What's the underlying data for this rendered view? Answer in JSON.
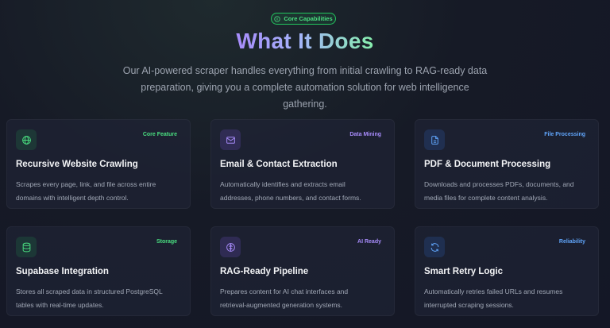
{
  "header": {
    "badge_label": "Core Capabilities",
    "title": "What It Does",
    "subtitle_line1": "Our AI-powered scraper handles everything from initial crawling to RAG-ready data",
    "subtitle_line2": "preparation, giving you a complete automation solution for web intelligence gathering."
  },
  "colors": {
    "green_accent": "#4ade80",
    "purple_accent": "#a78bfa",
    "blue_accent": "#60a5fa",
    "card_bg": "#1e2334"
  },
  "cards": [
    {
      "icon": "globe-icon",
      "tag": "Core Feature",
      "title": "Recursive Website Crawling",
      "desc_line1": "Scrapes every page, link, and file across entire",
      "desc_line2": "domains with intelligent depth control."
    },
    {
      "icon": "mail-icon",
      "tag": "Data Mining",
      "title": "Email & Contact Extraction",
      "desc_line1": "Automatically identifies and extracts email",
      "desc_line2": "addresses, phone numbers, and contact forms."
    },
    {
      "icon": "file-text-icon",
      "tag": "File Processing",
      "title": "PDF & Document Processing",
      "desc_line1": "Downloads and processes PDFs, documents, and",
      "desc_line2": "media files for complete content analysis."
    },
    {
      "icon": "database-icon",
      "tag": "Storage",
      "title": "Supabase Integration",
      "desc_line1": "Stores all scraped data in structured PostgreSQL",
      "desc_line2": "tables with real-time updates."
    },
    {
      "icon": "brain-icon",
      "tag": "AI Ready",
      "title": "RAG-Ready Pipeline",
      "desc_line1": "Prepares content for AI chat interfaces and",
      "desc_line2": "retrieval-augmented generation systems."
    },
    {
      "icon": "refresh-icon",
      "tag": "Reliability",
      "title": "Smart Retry Logic",
      "desc_line1": "Automatically retries failed URLs and resumes",
      "desc_line2": "interrupted scraping sessions."
    }
  ]
}
